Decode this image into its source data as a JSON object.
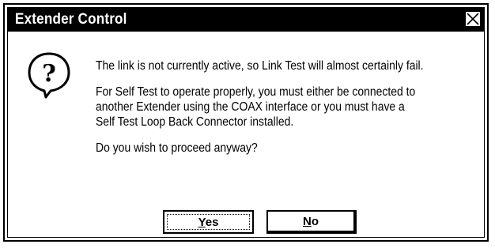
{
  "window": {
    "title": "Extender Control",
    "close_icon": "close-x-icon"
  },
  "icon": {
    "name": "question-balloon-icon",
    "glyph": "?"
  },
  "message": {
    "line1": "The link is not currently active, so Link Test will almost certainly fail.",
    "line2": "For Self Test to operate properly, you must either be connected to\nanother Extender using the COAX interface or you must have a\nSelf Test Loop Back Connector installed.",
    "line3": "Do you wish to proceed anyway?"
  },
  "buttons": {
    "yes": {
      "mnemonic": "Y",
      "rest": "es"
    },
    "no": {
      "mnemonic": "N",
      "rest": "o"
    }
  },
  "colors": {
    "titlebar": "#000000",
    "title_text": "#ffffff",
    "background": "#ffffff"
  }
}
